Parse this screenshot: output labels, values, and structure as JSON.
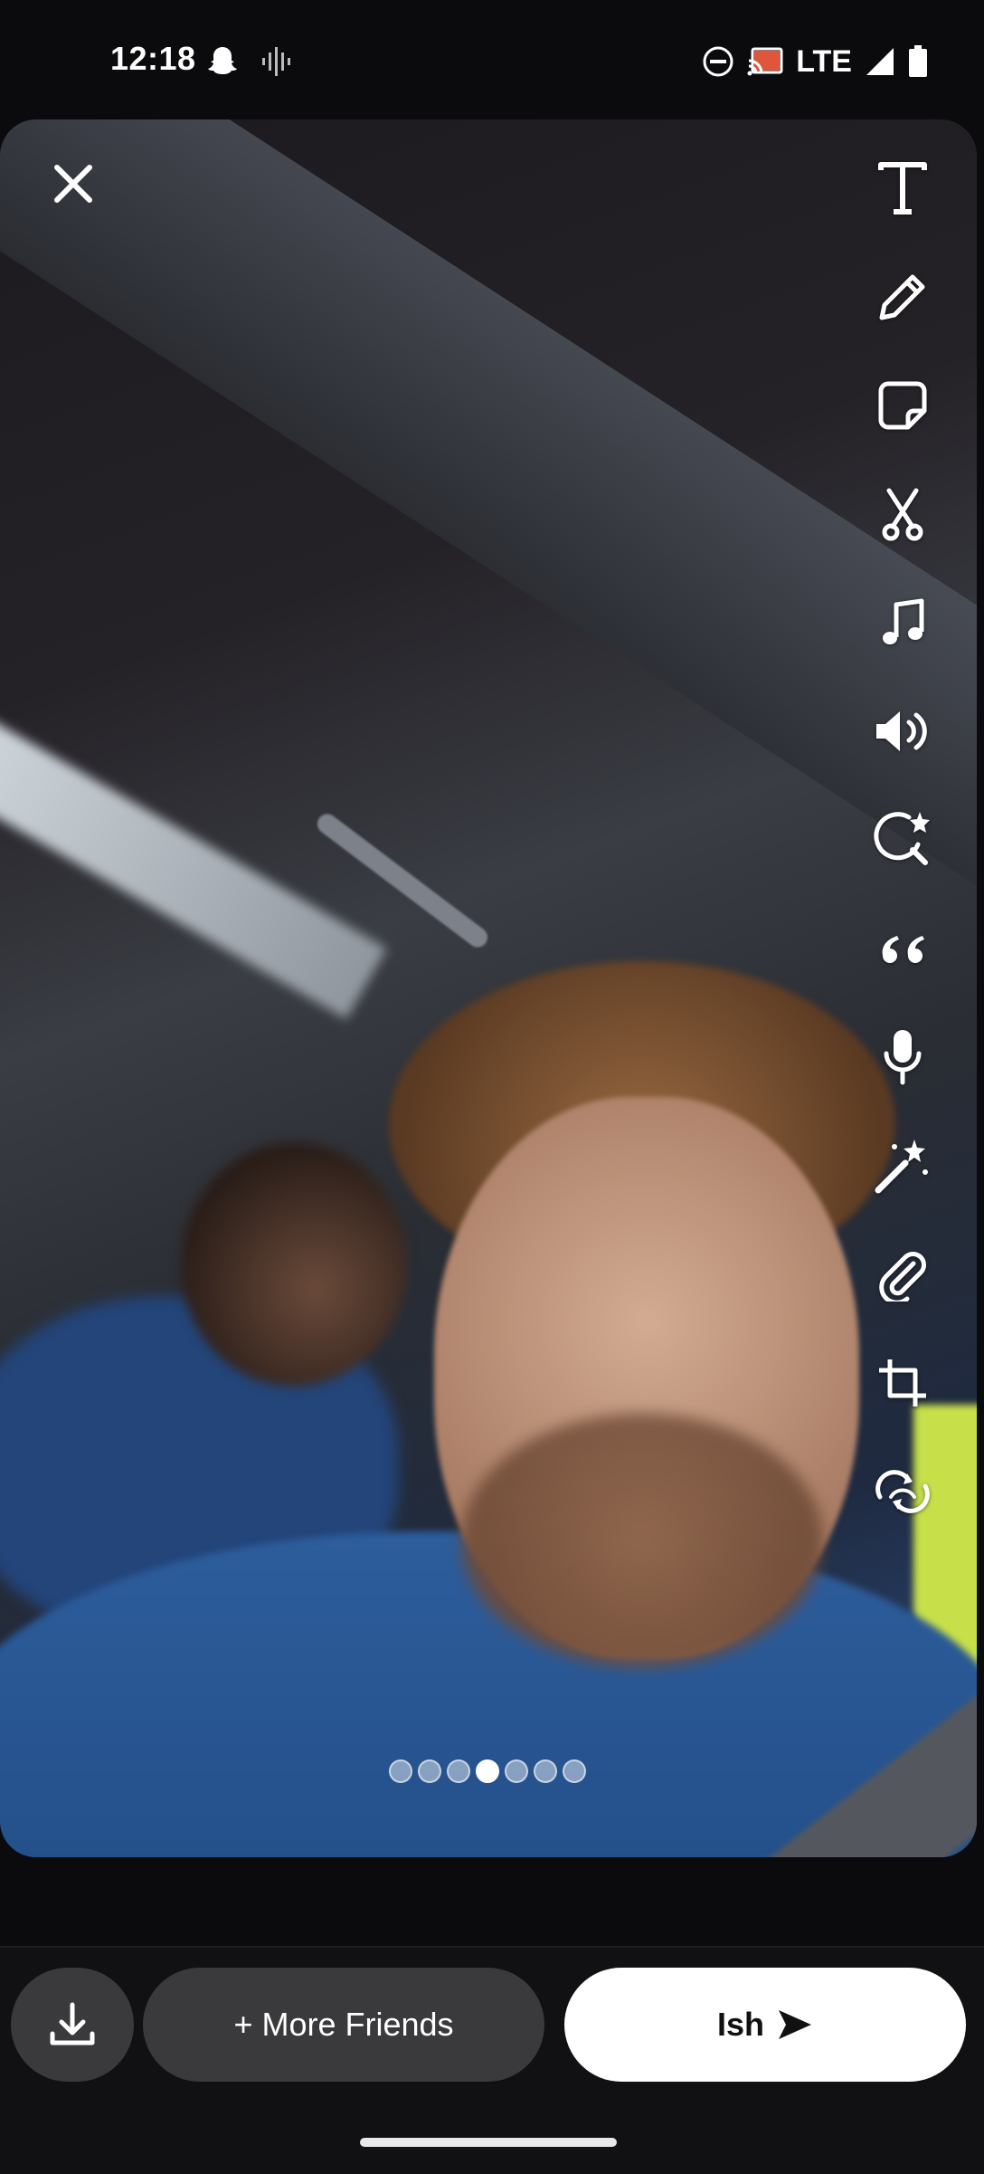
{
  "status_bar": {
    "time": "12:18",
    "network": "LTE",
    "icons": [
      "snapchat-ghost-icon",
      "voice-wave-icon",
      "do-not-disturb-icon",
      "cast-icon",
      "signal-icon",
      "battery-icon"
    ]
  },
  "editor": {
    "close_icon": "close-icon",
    "tools": [
      {
        "name": "text-tool",
        "icon": "text-icon"
      },
      {
        "name": "draw-tool",
        "icon": "pencil-icon"
      },
      {
        "name": "sticker-tool",
        "icon": "sticker-icon"
      },
      {
        "name": "scissors-tool",
        "icon": "scissors-icon"
      },
      {
        "name": "music-tool",
        "icon": "music-note-icon"
      },
      {
        "name": "sound-tool",
        "icon": "speaker-icon"
      },
      {
        "name": "lens-search-tool",
        "icon": "lens-search-icon"
      },
      {
        "name": "quote-tool",
        "icon": "quote-icon"
      },
      {
        "name": "voice-tool",
        "icon": "microphone-icon"
      },
      {
        "name": "magic-tool",
        "icon": "magic-wand-icon"
      },
      {
        "name": "attach-tool",
        "icon": "paperclip-icon"
      },
      {
        "name": "crop-tool",
        "icon": "crop-icon"
      },
      {
        "name": "loop-tool",
        "icon": "loop-icon"
      }
    ],
    "page_dots": {
      "count": 7,
      "active_index": 3
    }
  },
  "bottom_bar": {
    "save_icon": "download-icon",
    "more_friends_label": "+ More Friends",
    "send_label": "Ish",
    "send_icon": "send-arrow-icon"
  },
  "colors": {
    "background": "#0b0b0d",
    "button_dark": "#3a3a3c",
    "button_light": "#ffffff"
  }
}
